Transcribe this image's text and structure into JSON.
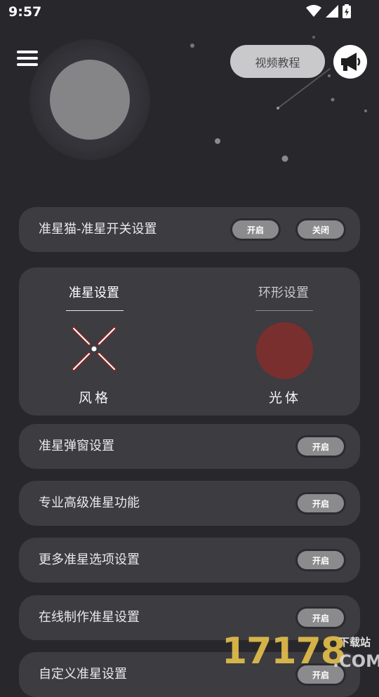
{
  "status_bar": {
    "time": "9:57"
  },
  "header": {
    "video_tutorial_label": "视频教程"
  },
  "master_toggle": {
    "label": "准星猫-准星开关设置",
    "on_label": "开启",
    "off_label": "关闭"
  },
  "crosshair_panel": {
    "tab_crosshair": "准星设置",
    "tab_ring": "环形设置",
    "style_label": "风格",
    "glow_label": "光体",
    "glow_color": "#7a2f2f",
    "crosshair_color": "#8a2a2a"
  },
  "settings": [
    {
      "label": "准星弹窗设置",
      "button": "开启"
    },
    {
      "label": "专业高级准星功能",
      "button": "开启"
    },
    {
      "label": "更多准星选项设置",
      "button": "开启"
    },
    {
      "label": "在线制作准星设置",
      "button": "开启"
    },
    {
      "label": "自定义准星设置",
      "button": "开启"
    }
  ],
  "watermark": {
    "number": "17178",
    "site_label": "下载站",
    "domain_suffix": ".COM"
  },
  "colors": {
    "background": "#28282c",
    "card": "#3c3c41",
    "button": "#8b8b8e"
  }
}
